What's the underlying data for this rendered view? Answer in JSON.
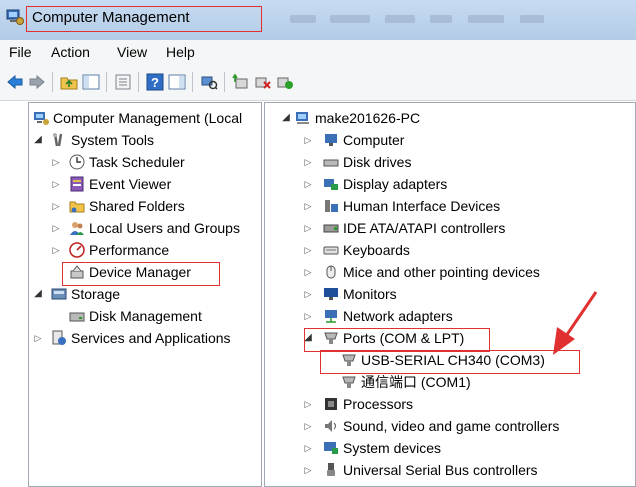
{
  "window": {
    "title": "Computer Management"
  },
  "menu": [
    "File",
    "Action",
    "View",
    "Help"
  ],
  "left_tree": {
    "root": "Computer Management (Local",
    "system_tools": "System Tools",
    "task_scheduler": "Task Scheduler",
    "event_viewer": "Event Viewer",
    "shared_folders": "Shared Folders",
    "local_users": "Local Users and Groups",
    "performance": "Performance",
    "device_manager": "Device Manager",
    "storage": "Storage",
    "disk_management": "Disk Management",
    "services": "Services and Applications"
  },
  "right_tree": {
    "root": "make201626-PC",
    "computer": "Computer",
    "disk_drives": "Disk drives",
    "display_adapters": "Display adapters",
    "hid": "Human Interface Devices",
    "ide": "IDE ATA/ATAPI controllers",
    "keyboards": "Keyboards",
    "mice": "Mice and other pointing devices",
    "monitors": "Monitors",
    "network": "Network adapters",
    "ports": "Ports (COM & LPT)",
    "usb_serial": "USB-SERIAL CH340 (COM3)",
    "com1": "通信端口 (COM1)",
    "processors": "Processors",
    "sound": "Sound, video and game controllers",
    "system_devices": "System devices",
    "usb_controllers": "Universal Serial Bus controllers"
  },
  "colors": {
    "highlight": "#e03030",
    "titlebar": "#c7dcf2"
  }
}
